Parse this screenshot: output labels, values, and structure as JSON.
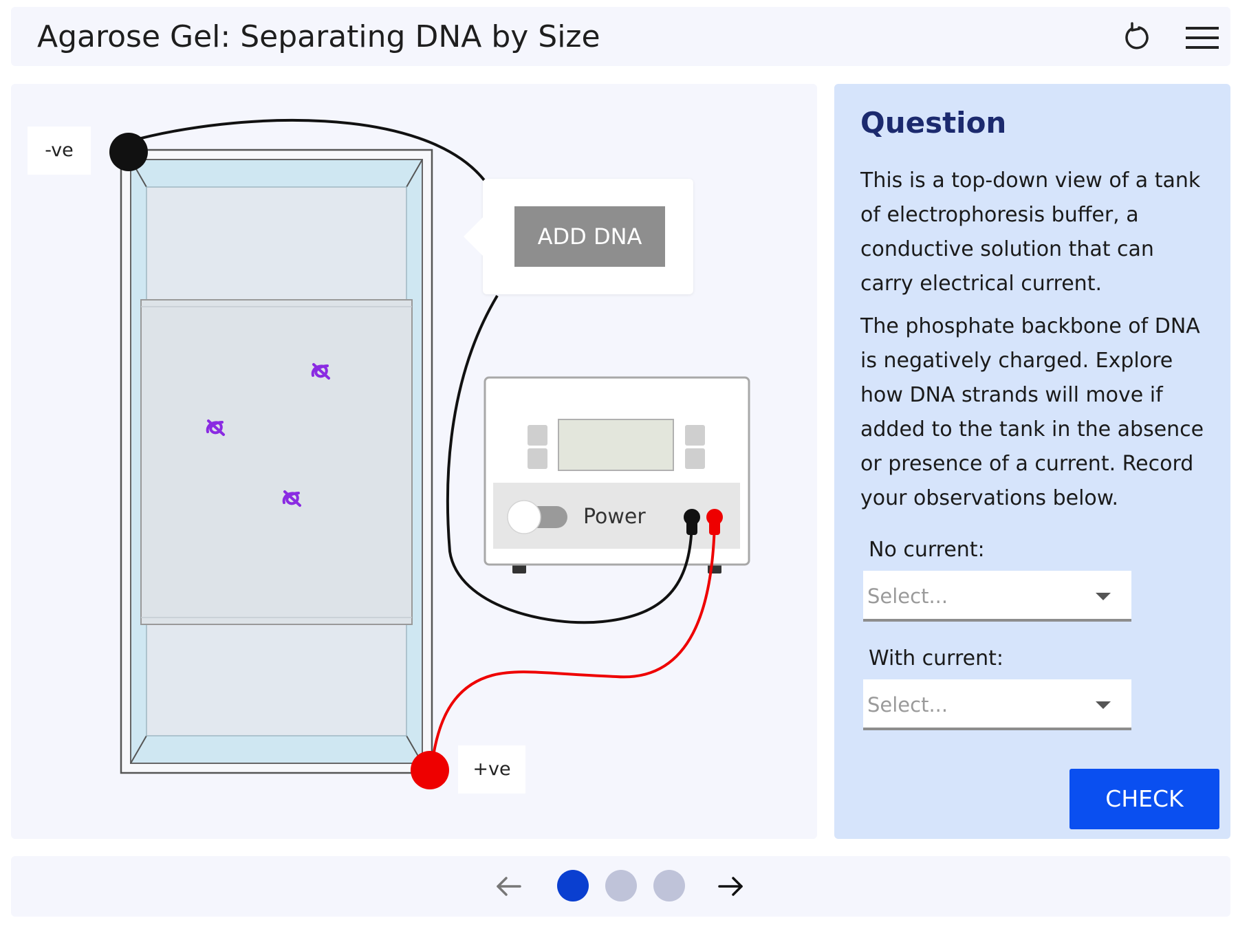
{
  "header": {
    "title": "Agarose Gel: Separating DNA by Size",
    "reset_icon": "reset-icon",
    "menu_icon": "hamburger-menu-icon"
  },
  "simulation": {
    "negative_label": "-ve",
    "positive_label": "+ve",
    "add_dna_label": "ADD DNA",
    "power_label": "Power",
    "power_on": false,
    "molecule_count": 3,
    "colors": {
      "negative_wire": "#111111",
      "positive_wire": "#ee0000",
      "dna": "#8a2be2",
      "buffer": "#cfe7f2",
      "gel": "#dde3e8"
    }
  },
  "question": {
    "heading": "Question",
    "paragraph1": "This is a top-down view of a tank of electrophoresis buffer, a conductive solution that can carry electrical current.",
    "paragraph2": "The phosphate backbone of DNA is negatively charged. Explore how DNA strands will move if added to the tank in the absence or presence of a current. Record your observations below.",
    "no_current_label": "No current:",
    "no_current_placeholder": "Select...",
    "with_current_label": "With current:",
    "with_current_placeholder": "Select...",
    "check_label": "CHECK"
  },
  "footer": {
    "pages": 3,
    "current_page": 1,
    "prev_icon": "arrow-left-icon",
    "next_icon": "arrow-right-icon",
    "colors": {
      "active_dot": "#0a3fd0",
      "inactive_dot": "#bfc3d9"
    }
  }
}
